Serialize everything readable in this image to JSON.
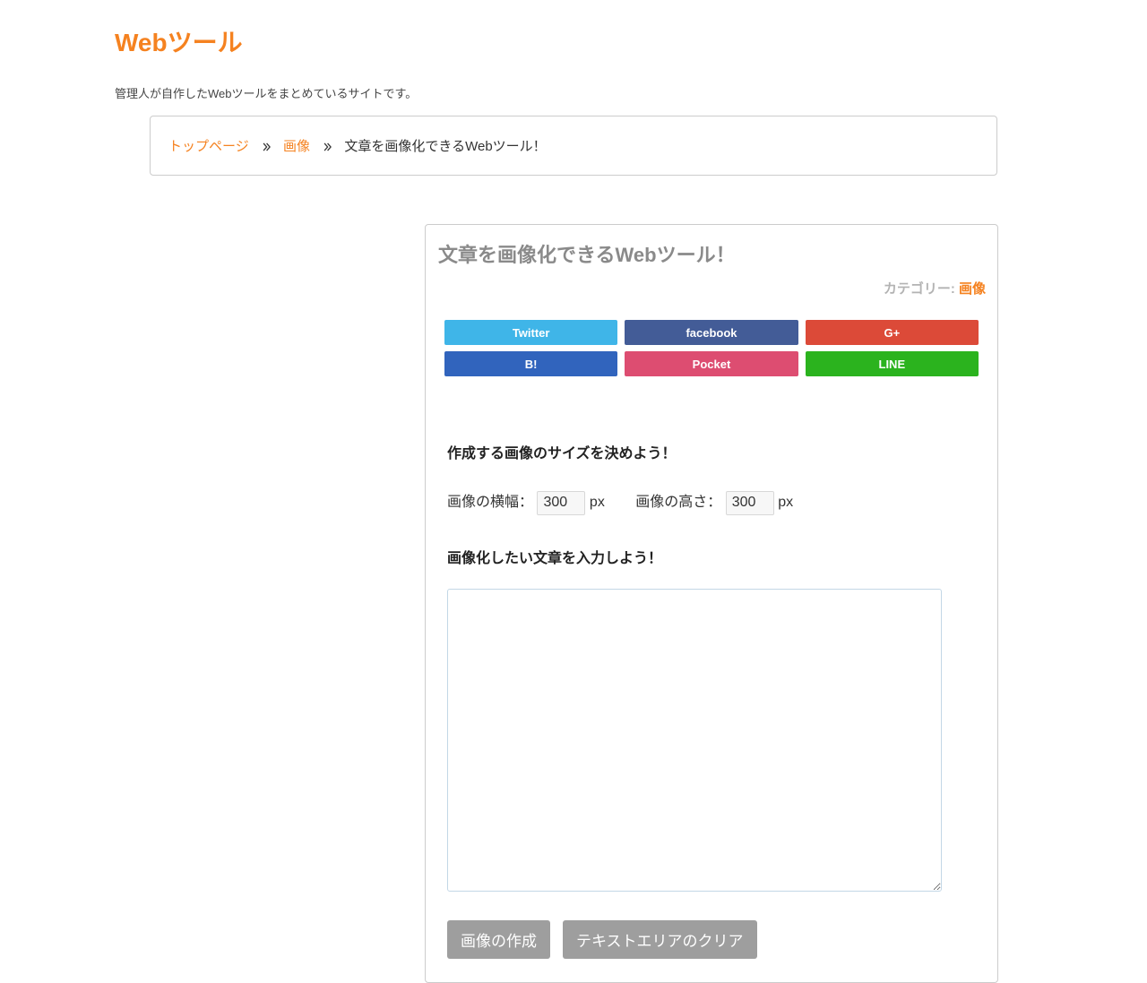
{
  "site": {
    "title": "Webツール",
    "description": "管理人が自作したWebツールをまとめているサイトです。"
  },
  "breadcrumb": {
    "items": [
      {
        "label": "トップページ"
      },
      {
        "label": "画像"
      }
    ],
    "current": "文章を画像化できるWebツール！"
  },
  "article": {
    "title": "文章を画像化できるWebツール！",
    "categoryLabel": "カテゴリー: ",
    "categoryLink": "画像"
  },
  "share": {
    "twitter": "Twitter",
    "facebook": "facebook",
    "gplus": "G+",
    "hatena": "B!",
    "pocket": "Pocket",
    "line": "LINE"
  },
  "form": {
    "sizeHeading": "作成する画像のサイズを決めよう！",
    "widthLabel": "画像の横幅：",
    "widthValue": "300",
    "heightLabel": "画像の高さ：",
    "heightValue": "300",
    "unit": "px",
    "textHeading": "画像化したい文章を入力しよう！",
    "textareaValue": "",
    "createButton": "画像の作成",
    "clearButton": "テキストエリアのクリア"
  }
}
